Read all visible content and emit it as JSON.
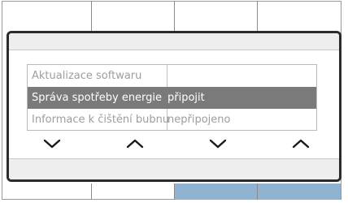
{
  "dialog": {
    "rows": [
      {
        "name": "Aktualizace softwaru",
        "value": ""
      },
      {
        "name": "Správa spotřeby energie",
        "value": "připojit"
      },
      {
        "name": "Informace k čištění bubnu",
        "value": "nepřipojeno"
      }
    ],
    "selected_index": 1,
    "buttons": [
      {
        "icon": "chevron-down-icon"
      },
      {
        "icon": "chevron-up-icon"
      },
      {
        "icon": "chevron-down-icon"
      },
      {
        "icon": "chevron-up-icon"
      }
    ]
  },
  "colors": {
    "selection": "#7a7a7a",
    "active_softkey": "#8fb3d1",
    "dialog_border": "#2b2b2b"
  }
}
